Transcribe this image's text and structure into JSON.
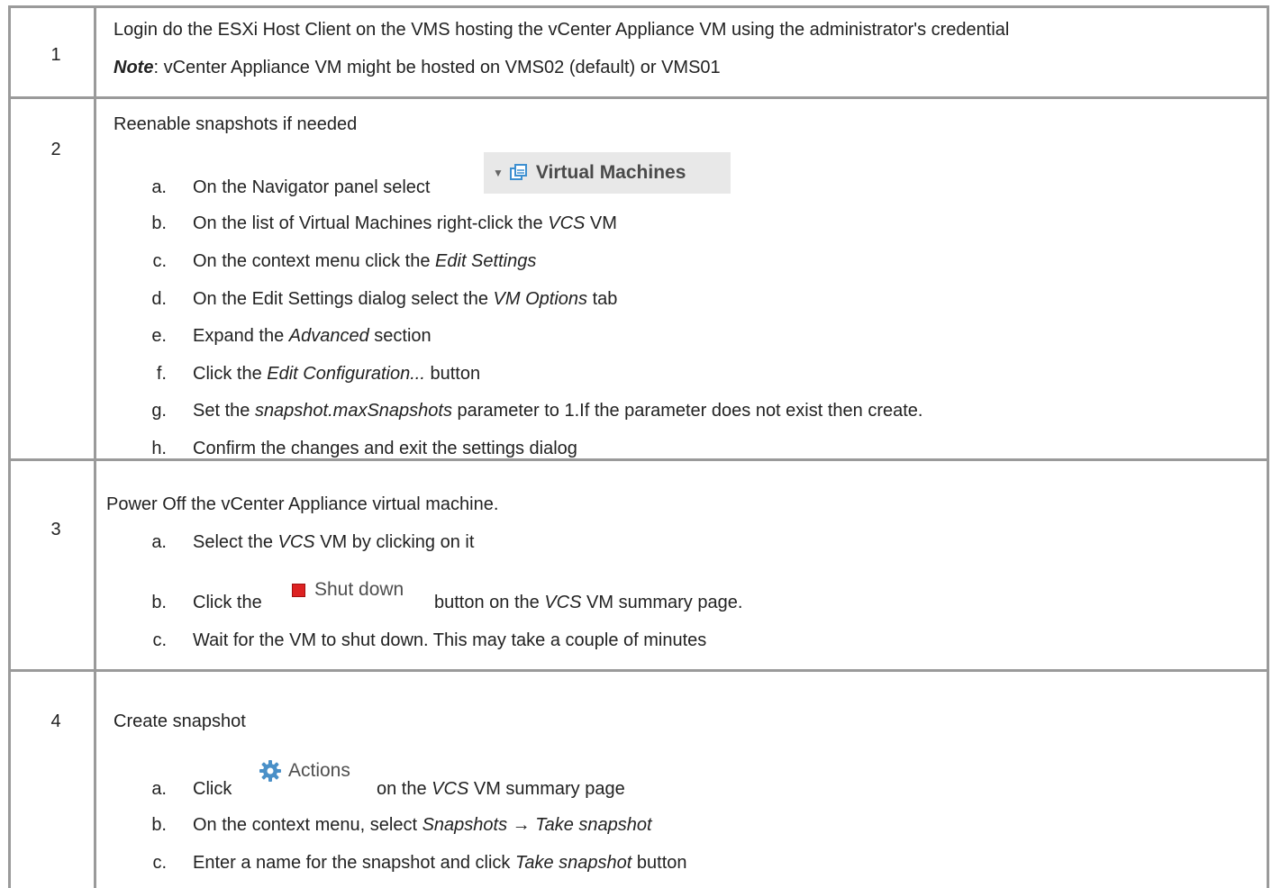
{
  "rows": [
    {
      "num": "1",
      "lines": [
        "Login do the ESXi Host Client on the VMS hosting the vCenter Appliance VM using the administrator's credential"
      ],
      "note_label": "Note",
      "note_text": ": vCenter Appliance VM might be hosted on VMS02 (default) or VMS01"
    },
    {
      "num": "2",
      "heading": "Reenable snapshots if needed",
      "steps": [
        {
          "m": "a.",
          "pre": "On the Navigator panel select",
          "chip": "Virtual Machines"
        },
        {
          "m": "b.",
          "pre": "On the list of Virtual Machines right-click the ",
          "em": "VCS",
          "post": " VM"
        },
        {
          "m": "c.",
          "pre": "On the context menu click the ",
          "em": "Edit Settings",
          "post": ""
        },
        {
          "m": "d.",
          "pre": "On the Edit Settings dialog select the ",
          "em": "VM Options",
          "post": " tab"
        },
        {
          "m": "e.",
          "pre": "Expand the ",
          "em": "Advanced",
          "post": " section"
        },
        {
          "m": "f.",
          "pre": "Click the ",
          "em": "Edit Configuration...",
          "post": " button"
        },
        {
          "m": "g.",
          "pre": "Set the ",
          "em": "snapshot.maxSnapshots",
          "post": " parameter to 1.If the parameter does not exist then create."
        },
        {
          "m": "h.",
          "pre": "Confirm the changes and exit the settings dialog",
          "em": "",
          "post": ""
        }
      ]
    },
    {
      "num": "3",
      "heading": "Power Off the vCenter Appliance virtual machine.",
      "steps": [
        {
          "m": "a.",
          "pre": "Select the ",
          "em": "VCS",
          "post": " VM by clicking on it"
        },
        {
          "m": "b.",
          "pre": "Click the",
          "chip": "Shut down",
          "post_pre": "button on the ",
          "em": "VCS",
          "post": " VM summary page."
        },
        {
          "m": "c.",
          "pre": "Wait for the VM to shut down. This may take a couple of minutes",
          "em": "",
          "post": ""
        }
      ]
    },
    {
      "num": "4",
      "heading": "Create snapshot",
      "steps": [
        {
          "m": "a.",
          "pre": "Click",
          "chip": "Actions",
          "post_pre": "on the ",
          "em": "VCS",
          "post": " VM summary page"
        },
        {
          "m": "b.",
          "pre": "On the context menu, select ",
          "em": "Snapshots → Take snapshot",
          "post": ""
        },
        {
          "m": "c.",
          "pre": "Enter a name for the snapshot and click ",
          "em": "Take snapshot",
          "post": " button"
        }
      ]
    }
  ],
  "icons": {
    "vm_icon": "virtual-machines-icon",
    "shutdown_icon": "stop-icon",
    "actions_icon": "gear-icon"
  },
  "colors": {
    "grid": "#9a9a9a",
    "text": "#222222",
    "stop_red": "#dd2222",
    "gear_blue": "#4a90c8"
  }
}
